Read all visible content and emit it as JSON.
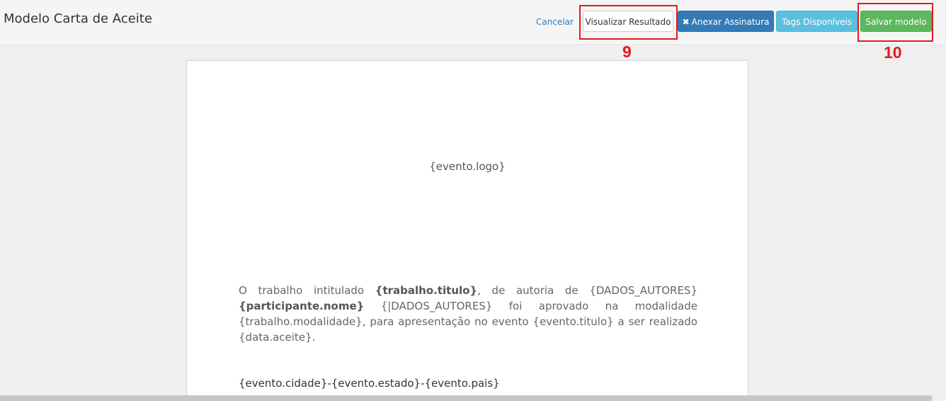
{
  "header": {
    "title": "Modelo Carta de Aceite",
    "buttons": {
      "cancel": "Cancelar",
      "preview": "Visualizar Resultado",
      "attach_signature": "Anexar Assinatura",
      "attach_icon": "close-icon",
      "tags": "Tags Disponíveis",
      "save": "Salvar modelo"
    }
  },
  "annotations": {
    "marker_9": "9",
    "marker_10": "10",
    "color": "#e41a1c"
  },
  "document": {
    "logo": "{evento.logo}",
    "paragraph": {
      "p1": "O trabalho intitulado ",
      "b1": "{trabalho.titulo}",
      "p2": ", de autoria de {DADOS_AUTORES} ",
      "b2": "{participante.nome}",
      "p3": " {|DADOS_AUTORES} foi aprovado na modalidade {trabalho.modalidade}, para apresentação no evento {evento.titulo} a ser realizado {data.aceite}."
    },
    "location": "{evento.cidade}-{evento.estado}-{evento.pais}"
  },
  "colors": {
    "primary": "#337ab7",
    "info": "#5bc0de",
    "success": "#5cb85c"
  }
}
